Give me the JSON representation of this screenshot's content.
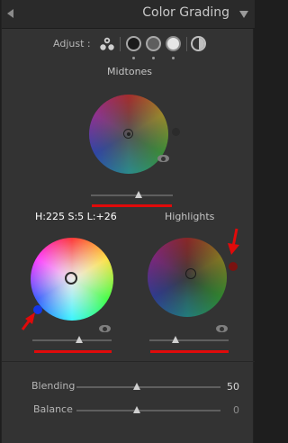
{
  "header": {
    "title": "Color Grading",
    "left_icon": "triangle-left-icon",
    "collapse_icon": "triangle-down-icon"
  },
  "adjust": {
    "label": "Adjust :",
    "modes": [
      {
        "name": "three-way",
        "icon": "three-circles-icon"
      },
      {
        "name": "shadows",
        "icon": "dark-circle-icon"
      },
      {
        "name": "midtones",
        "icon": "gray-circle-icon",
        "selected": true
      },
      {
        "name": "highlights",
        "icon": "white-circle-icon"
      },
      {
        "name": "global",
        "icon": "half-filled-circle-icon"
      }
    ]
  },
  "midtones": {
    "label": "Midtones",
    "luminance": 0.59
  },
  "readout": {
    "text": "H:225 S:5 L:+26"
  },
  "shadows": {
    "luminance": 0.6,
    "hue": 225,
    "saturation": "high",
    "handle_color": "#1436e6"
  },
  "highlights": {
    "label": "Highlights",
    "luminance": 0.34,
    "handle_color": "#7a1210"
  },
  "params": {
    "blending": {
      "label": "Blending",
      "value": "50",
      "level": 0.42
    },
    "balance": {
      "label": "Balance",
      "value": "0",
      "level": 0.42
    }
  },
  "colors": {
    "annotation": "#e00a0a"
  }
}
